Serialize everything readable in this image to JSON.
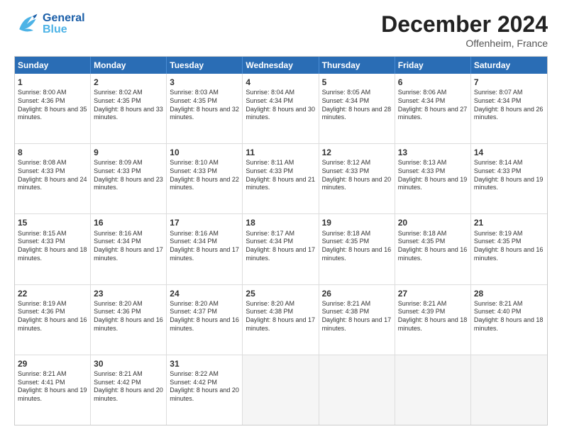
{
  "header": {
    "logo_general": "General",
    "logo_blue": "Blue",
    "month_title": "December 2024",
    "location": "Offenheim, France"
  },
  "days_of_week": [
    "Sunday",
    "Monday",
    "Tuesday",
    "Wednesday",
    "Thursday",
    "Friday",
    "Saturday"
  ],
  "weeks": [
    [
      {
        "day": "1",
        "sunrise": "8:00 AM",
        "sunset": "4:36 PM",
        "daylight": "8 hours and 35 minutes."
      },
      {
        "day": "2",
        "sunrise": "8:02 AM",
        "sunset": "4:35 PM",
        "daylight": "8 hours and 33 minutes."
      },
      {
        "day": "3",
        "sunrise": "8:03 AM",
        "sunset": "4:35 PM",
        "daylight": "8 hours and 32 minutes."
      },
      {
        "day": "4",
        "sunrise": "8:04 AM",
        "sunset": "4:34 PM",
        "daylight": "8 hours and 30 minutes."
      },
      {
        "day": "5",
        "sunrise": "8:05 AM",
        "sunset": "4:34 PM",
        "daylight": "8 hours and 28 minutes."
      },
      {
        "day": "6",
        "sunrise": "8:06 AM",
        "sunset": "4:34 PM",
        "daylight": "8 hours and 27 minutes."
      },
      {
        "day": "7",
        "sunrise": "8:07 AM",
        "sunset": "4:34 PM",
        "daylight": "8 hours and 26 minutes."
      }
    ],
    [
      {
        "day": "8",
        "sunrise": "8:08 AM",
        "sunset": "4:33 PM",
        "daylight": "8 hours and 24 minutes."
      },
      {
        "day": "9",
        "sunrise": "8:09 AM",
        "sunset": "4:33 PM",
        "daylight": "8 hours and 23 minutes."
      },
      {
        "day": "10",
        "sunrise": "8:10 AM",
        "sunset": "4:33 PM",
        "daylight": "8 hours and 22 minutes."
      },
      {
        "day": "11",
        "sunrise": "8:11 AM",
        "sunset": "4:33 PM",
        "daylight": "8 hours and 21 minutes."
      },
      {
        "day": "12",
        "sunrise": "8:12 AM",
        "sunset": "4:33 PM",
        "daylight": "8 hours and 20 minutes."
      },
      {
        "day": "13",
        "sunrise": "8:13 AM",
        "sunset": "4:33 PM",
        "daylight": "8 hours and 19 minutes."
      },
      {
        "day": "14",
        "sunrise": "8:14 AM",
        "sunset": "4:33 PM",
        "daylight": "8 hours and 19 minutes."
      }
    ],
    [
      {
        "day": "15",
        "sunrise": "8:15 AM",
        "sunset": "4:33 PM",
        "daylight": "8 hours and 18 minutes."
      },
      {
        "day": "16",
        "sunrise": "8:16 AM",
        "sunset": "4:34 PM",
        "daylight": "8 hours and 17 minutes."
      },
      {
        "day": "17",
        "sunrise": "8:16 AM",
        "sunset": "4:34 PM",
        "daylight": "8 hours and 17 minutes."
      },
      {
        "day": "18",
        "sunrise": "8:17 AM",
        "sunset": "4:34 PM",
        "daylight": "8 hours and 17 minutes."
      },
      {
        "day": "19",
        "sunrise": "8:18 AM",
        "sunset": "4:35 PM",
        "daylight": "8 hours and 16 minutes."
      },
      {
        "day": "20",
        "sunrise": "8:18 AM",
        "sunset": "4:35 PM",
        "daylight": "8 hours and 16 minutes."
      },
      {
        "day": "21",
        "sunrise": "8:19 AM",
        "sunset": "4:35 PM",
        "daylight": "8 hours and 16 minutes."
      }
    ],
    [
      {
        "day": "22",
        "sunrise": "8:19 AM",
        "sunset": "4:36 PM",
        "daylight": "8 hours and 16 minutes."
      },
      {
        "day": "23",
        "sunrise": "8:20 AM",
        "sunset": "4:36 PM",
        "daylight": "8 hours and 16 minutes."
      },
      {
        "day": "24",
        "sunrise": "8:20 AM",
        "sunset": "4:37 PM",
        "daylight": "8 hours and 16 minutes."
      },
      {
        "day": "25",
        "sunrise": "8:20 AM",
        "sunset": "4:38 PM",
        "daylight": "8 hours and 17 minutes."
      },
      {
        "day": "26",
        "sunrise": "8:21 AM",
        "sunset": "4:38 PM",
        "daylight": "8 hours and 17 minutes."
      },
      {
        "day": "27",
        "sunrise": "8:21 AM",
        "sunset": "4:39 PM",
        "daylight": "8 hours and 18 minutes."
      },
      {
        "day": "28",
        "sunrise": "8:21 AM",
        "sunset": "4:40 PM",
        "daylight": "8 hours and 18 minutes."
      }
    ],
    [
      {
        "day": "29",
        "sunrise": "8:21 AM",
        "sunset": "4:41 PM",
        "daylight": "8 hours and 19 minutes."
      },
      {
        "day": "30",
        "sunrise": "8:21 AM",
        "sunset": "4:42 PM",
        "daylight": "8 hours and 20 minutes."
      },
      {
        "day": "31",
        "sunrise": "8:22 AM",
        "sunset": "4:42 PM",
        "daylight": "8 hours and 20 minutes."
      },
      null,
      null,
      null,
      null
    ]
  ],
  "labels": {
    "sunrise": "Sunrise:",
    "sunset": "Sunset:",
    "daylight": "Daylight:"
  }
}
